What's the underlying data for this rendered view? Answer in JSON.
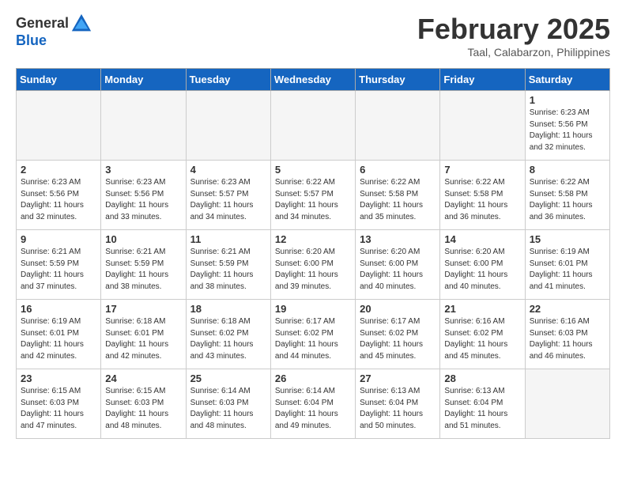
{
  "header": {
    "logo_general": "General",
    "logo_blue": "Blue",
    "title": "February 2025",
    "subtitle": "Taal, Calabarzon, Philippines"
  },
  "days_of_week": [
    "Sunday",
    "Monday",
    "Tuesday",
    "Wednesday",
    "Thursday",
    "Friday",
    "Saturday"
  ],
  "weeks": [
    [
      {
        "day": "",
        "info": ""
      },
      {
        "day": "",
        "info": ""
      },
      {
        "day": "",
        "info": ""
      },
      {
        "day": "",
        "info": ""
      },
      {
        "day": "",
        "info": ""
      },
      {
        "day": "",
        "info": ""
      },
      {
        "day": "1",
        "info": "Sunrise: 6:23 AM\nSunset: 5:56 PM\nDaylight: 11 hours and 32 minutes."
      }
    ],
    [
      {
        "day": "2",
        "info": "Sunrise: 6:23 AM\nSunset: 5:56 PM\nDaylight: 11 hours and 32 minutes."
      },
      {
        "day": "3",
        "info": "Sunrise: 6:23 AM\nSunset: 5:56 PM\nDaylight: 11 hours and 33 minutes."
      },
      {
        "day": "4",
        "info": "Sunrise: 6:23 AM\nSunset: 5:57 PM\nDaylight: 11 hours and 34 minutes."
      },
      {
        "day": "5",
        "info": "Sunrise: 6:22 AM\nSunset: 5:57 PM\nDaylight: 11 hours and 34 minutes."
      },
      {
        "day": "6",
        "info": "Sunrise: 6:22 AM\nSunset: 5:58 PM\nDaylight: 11 hours and 35 minutes."
      },
      {
        "day": "7",
        "info": "Sunrise: 6:22 AM\nSunset: 5:58 PM\nDaylight: 11 hours and 36 minutes."
      },
      {
        "day": "8",
        "info": "Sunrise: 6:22 AM\nSunset: 5:58 PM\nDaylight: 11 hours and 36 minutes."
      }
    ],
    [
      {
        "day": "9",
        "info": "Sunrise: 6:21 AM\nSunset: 5:59 PM\nDaylight: 11 hours and 37 minutes."
      },
      {
        "day": "10",
        "info": "Sunrise: 6:21 AM\nSunset: 5:59 PM\nDaylight: 11 hours and 38 minutes."
      },
      {
        "day": "11",
        "info": "Sunrise: 6:21 AM\nSunset: 5:59 PM\nDaylight: 11 hours and 38 minutes."
      },
      {
        "day": "12",
        "info": "Sunrise: 6:20 AM\nSunset: 6:00 PM\nDaylight: 11 hours and 39 minutes."
      },
      {
        "day": "13",
        "info": "Sunrise: 6:20 AM\nSunset: 6:00 PM\nDaylight: 11 hours and 40 minutes."
      },
      {
        "day": "14",
        "info": "Sunrise: 6:20 AM\nSunset: 6:00 PM\nDaylight: 11 hours and 40 minutes."
      },
      {
        "day": "15",
        "info": "Sunrise: 6:19 AM\nSunset: 6:01 PM\nDaylight: 11 hours and 41 minutes."
      }
    ],
    [
      {
        "day": "16",
        "info": "Sunrise: 6:19 AM\nSunset: 6:01 PM\nDaylight: 11 hours and 42 minutes."
      },
      {
        "day": "17",
        "info": "Sunrise: 6:18 AM\nSunset: 6:01 PM\nDaylight: 11 hours and 42 minutes."
      },
      {
        "day": "18",
        "info": "Sunrise: 6:18 AM\nSunset: 6:02 PM\nDaylight: 11 hours and 43 minutes."
      },
      {
        "day": "19",
        "info": "Sunrise: 6:17 AM\nSunset: 6:02 PM\nDaylight: 11 hours and 44 minutes."
      },
      {
        "day": "20",
        "info": "Sunrise: 6:17 AM\nSunset: 6:02 PM\nDaylight: 11 hours and 45 minutes."
      },
      {
        "day": "21",
        "info": "Sunrise: 6:16 AM\nSunset: 6:02 PM\nDaylight: 11 hours and 45 minutes."
      },
      {
        "day": "22",
        "info": "Sunrise: 6:16 AM\nSunset: 6:03 PM\nDaylight: 11 hours and 46 minutes."
      }
    ],
    [
      {
        "day": "23",
        "info": "Sunrise: 6:15 AM\nSunset: 6:03 PM\nDaylight: 11 hours and 47 minutes."
      },
      {
        "day": "24",
        "info": "Sunrise: 6:15 AM\nSunset: 6:03 PM\nDaylight: 11 hours and 48 minutes."
      },
      {
        "day": "25",
        "info": "Sunrise: 6:14 AM\nSunset: 6:03 PM\nDaylight: 11 hours and 48 minutes."
      },
      {
        "day": "26",
        "info": "Sunrise: 6:14 AM\nSunset: 6:04 PM\nDaylight: 11 hours and 49 minutes."
      },
      {
        "day": "27",
        "info": "Sunrise: 6:13 AM\nSunset: 6:04 PM\nDaylight: 11 hours and 50 minutes."
      },
      {
        "day": "28",
        "info": "Sunrise: 6:13 AM\nSunset: 6:04 PM\nDaylight: 11 hours and 51 minutes."
      },
      {
        "day": "",
        "info": ""
      }
    ]
  ]
}
